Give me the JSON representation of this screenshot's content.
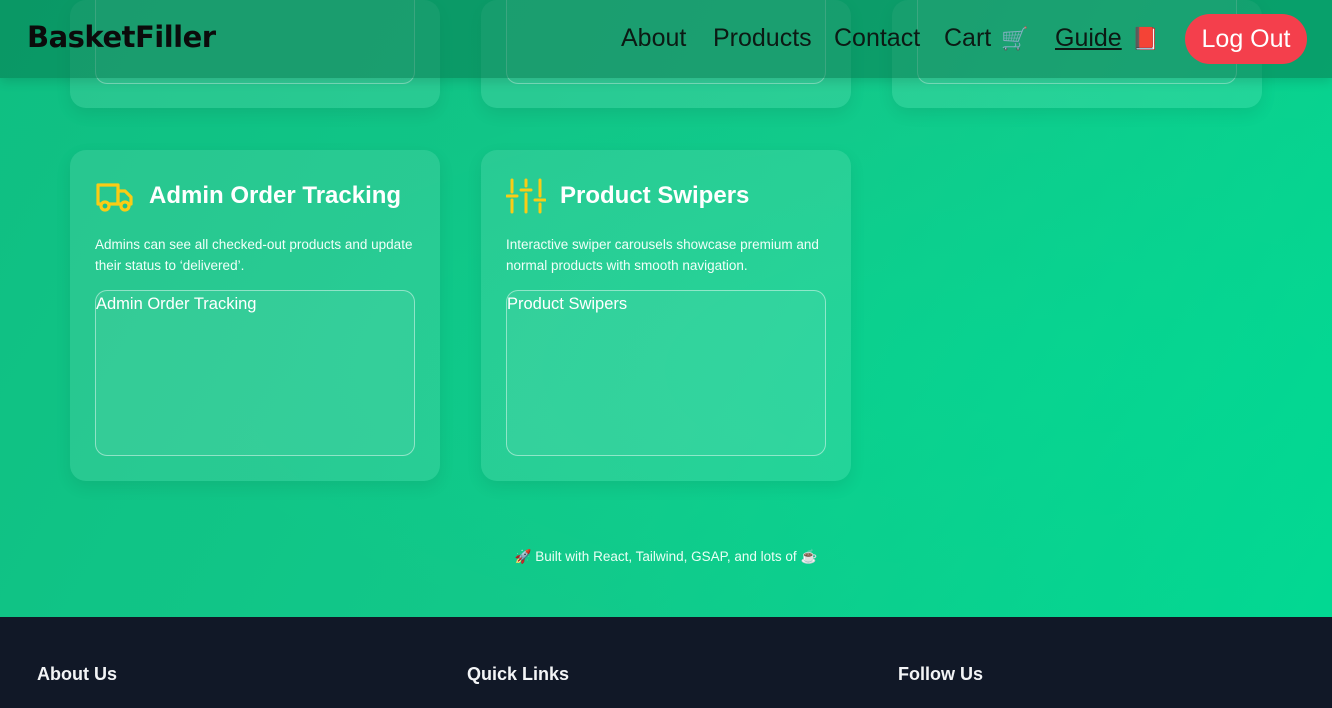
{
  "navbar": {
    "brand": "BasketFiller",
    "links": {
      "about": "About",
      "products": "Products",
      "contact": "Contact",
      "cart": "Cart",
      "cart_emoji": "🛒",
      "guide": "Guide",
      "guide_emoji": "📕"
    },
    "logout": "Log Out"
  },
  "features": [
    {
      "icon": "truck-icon",
      "title": "Admin Order Tracking",
      "description": "Admins can see all checked-out products and update their status to ‘delivered’.",
      "preview_label": "Admin Order Tracking"
    },
    {
      "icon": "sliders-icon",
      "title": "Product Swipers",
      "description": "Interactive swiper carousels showcase premium and normal products with smooth navigation.",
      "preview_label": "Product Swipers"
    }
  ],
  "built_with": {
    "rocket": "🚀",
    "text": "Built with React, Tailwind, GSAP, and lots of",
    "coffee": "☕"
  },
  "footer": {
    "about_heading": "About Us",
    "links_heading": "Quick Links",
    "follow_heading": "Follow Us"
  },
  "colors": {
    "accent_icon": "#facc15",
    "logout": "#f43f4c",
    "footer_bg": "#111827"
  }
}
